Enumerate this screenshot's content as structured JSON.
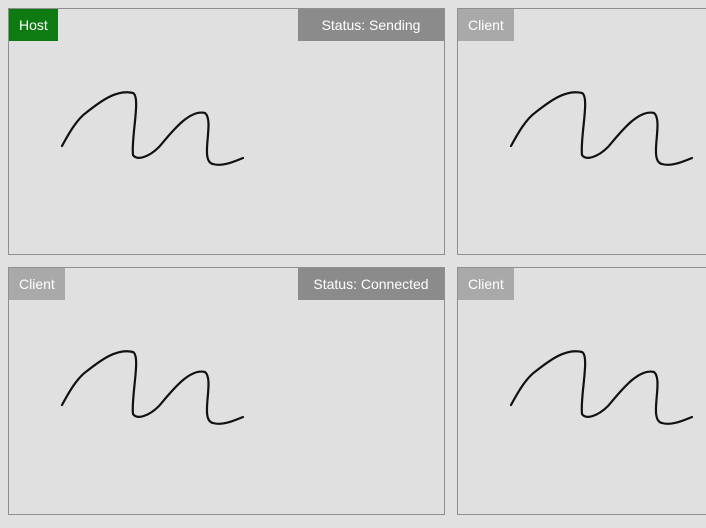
{
  "panels": {
    "host": {
      "role": "Host",
      "status": "Status: Sending"
    },
    "top_right": {
      "role": "Client"
    },
    "bottom_left": {
      "role": "Client",
      "status": "Status: Connected"
    },
    "bottom_right": {
      "role": "Client"
    }
  },
  "colors": {
    "host_badge": "#0d7a12",
    "client_badge": "#a9a9a9",
    "status_badge": "#8b8b8b",
    "stroke": "#111111"
  }
}
